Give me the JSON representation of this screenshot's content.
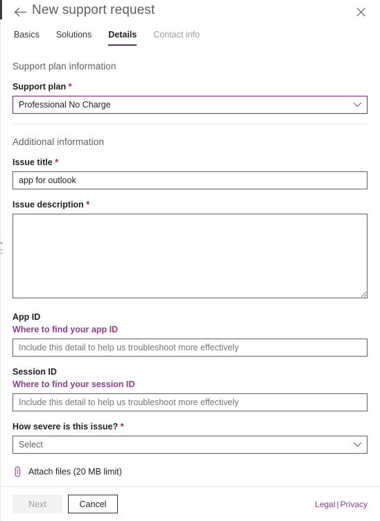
{
  "window": {
    "title": "New support request",
    "back_icon": "back-arrow-icon",
    "close_icon": "close-icon"
  },
  "tabs": [
    {
      "label": "Basics",
      "state": "normal"
    },
    {
      "label": "Solutions",
      "state": "normal"
    },
    {
      "label": "Details",
      "state": "active"
    },
    {
      "label": "Contact info",
      "state": "disabled"
    }
  ],
  "sections": {
    "support_plan": {
      "heading": "Support plan information",
      "plan_label": "Support plan",
      "plan_required": "*",
      "plan_value": "Professional No Charge"
    },
    "additional": {
      "heading": "Additional information",
      "issue_title_label": "Issue title",
      "issue_title_required": "*",
      "issue_title_value": "app for outlook",
      "issue_description_label": "Issue description",
      "issue_description_required": "*",
      "issue_description_value": "",
      "app_id_label": "App ID",
      "app_id_link": "Where to find your app ID",
      "app_id_placeholder": "Include this detail to help us troubleshoot more effectively",
      "app_id_value": "",
      "session_id_label": "Session ID",
      "session_id_link": "Where to find your session ID",
      "session_id_placeholder": "Include this detail to help us troubleshoot more effectively",
      "session_id_value": "",
      "severity_label": "How severe is this issue?",
      "severity_required": "*",
      "severity_value": "Select"
    }
  },
  "attach": {
    "label": "Attach files (20 MB limit)",
    "icon": "paperclip-icon"
  },
  "footer": {
    "next_label": "Next",
    "cancel_label": "Cancel",
    "legal_label": "Legal",
    "separator": "|",
    "privacy_label": "Privacy"
  },
  "colors": {
    "accent_purple": "#5c2d5c",
    "link_purple": "#8c3f8c",
    "focus_border": "#742774",
    "required_red": "#a4262c",
    "border_grey": "#605e5c",
    "divider": "#edebe9"
  }
}
